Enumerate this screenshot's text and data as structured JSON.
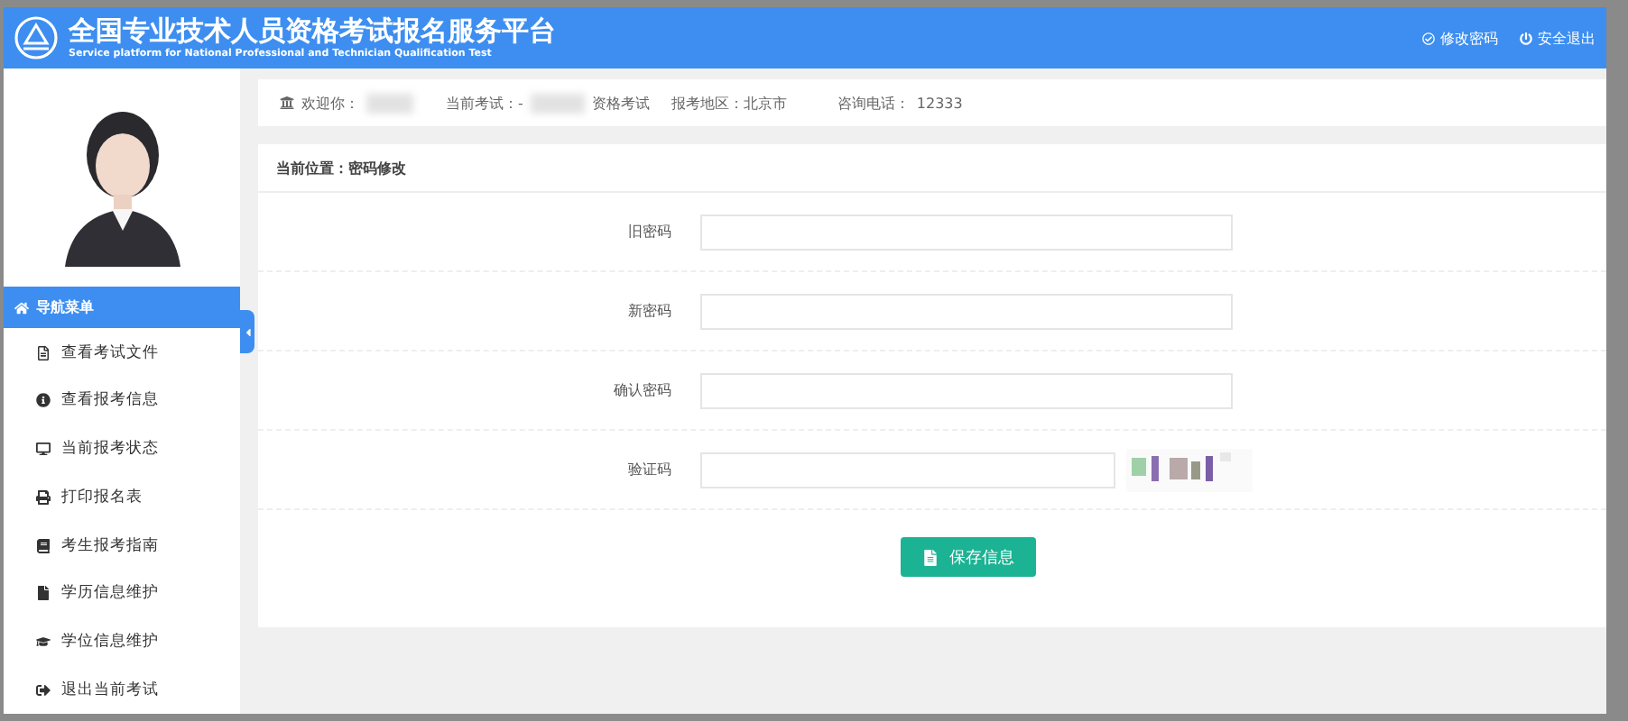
{
  "header": {
    "title": "全国专业技术人员资格考试报名服务平台",
    "subtitle": "Service platform for National Professional and Technician Qualification Test",
    "links": [
      "修改密码",
      "安全退出"
    ]
  },
  "sidebar": {
    "nav_header": "导航菜单",
    "items": [
      {
        "label": "查看考试文件"
      },
      {
        "label": "查看报考信息"
      },
      {
        "label": "当前报考状态"
      },
      {
        "label": "打印报名表"
      },
      {
        "label": "考生报考指南"
      },
      {
        "label": "学历信息维护"
      },
      {
        "label": "学位信息维护"
      },
      {
        "label": "退出当前考试"
      }
    ]
  },
  "info_bar": {
    "welcome": "欢迎你：",
    "exam_label": "当前考试：-",
    "exam_suffix": "资格考试",
    "region": "报考地区：北京市",
    "phone_label": "咨询电话：",
    "phone": "12333"
  },
  "breadcrumb": "当前位置：密码修改",
  "form": {
    "fields": [
      {
        "label": "旧密码",
        "kind": "password"
      },
      {
        "label": "新密码",
        "kind": "password"
      },
      {
        "label": "确认密码",
        "kind": "password"
      },
      {
        "label": "验证码",
        "kind": "captcha"
      }
    ],
    "submit": "保存信息"
  }
}
